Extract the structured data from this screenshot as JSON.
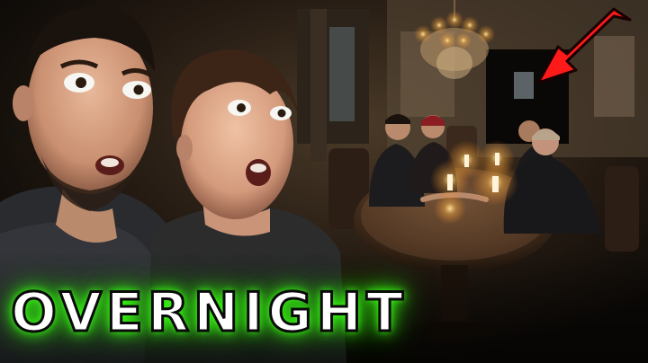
{
  "caption": {
    "text": "OVERNIGHT",
    "text_color": "#ffffff",
    "glow_color": "#39ff14"
  },
  "accent": {
    "arrow_color": "#ff1a1a"
  }
}
